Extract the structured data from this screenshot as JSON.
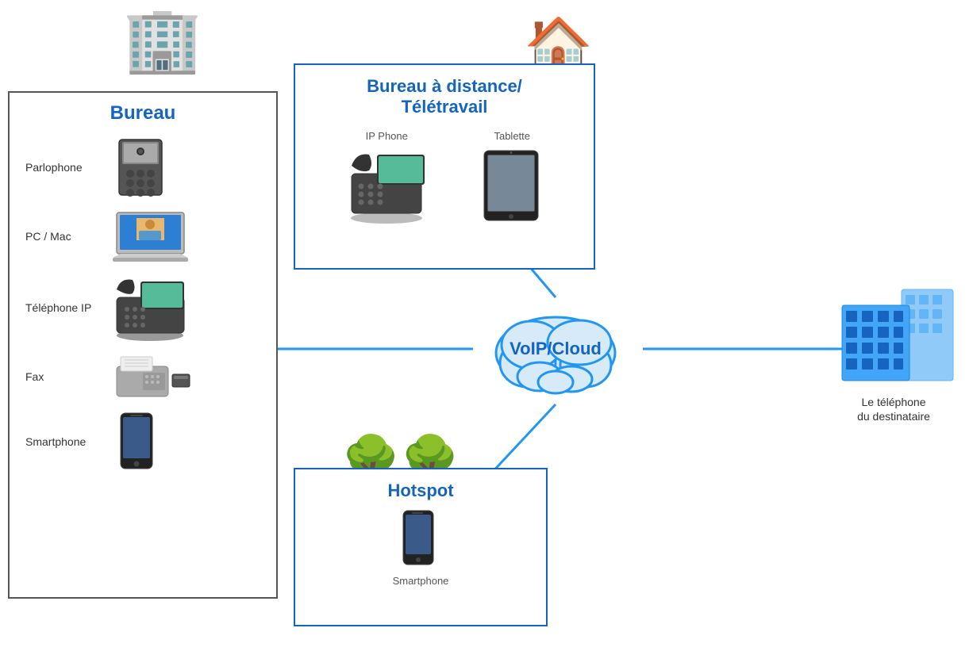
{
  "bureau": {
    "title": "Bureau",
    "items": [
      {
        "label": "Parlophone",
        "icon": "🔲",
        "emoji": "parlophone"
      },
      {
        "label": "PC / Mac",
        "icon": "💻",
        "emoji": "laptop"
      },
      {
        "label": "Téléphone IP",
        "icon": "📞",
        "emoji": "ip-phone"
      },
      {
        "label": "Fax",
        "icon": "🖨️",
        "emoji": "fax"
      },
      {
        "label": "Smartphone",
        "icon": "📱",
        "emoji": "smartphone"
      }
    ]
  },
  "remote": {
    "title_line1": "Bureau à distance/",
    "title_line2": "Télétravail",
    "items": [
      {
        "label": "IP Phone",
        "icon": "📞"
      },
      {
        "label": "Tablette",
        "icon": "📱"
      }
    ]
  },
  "hotspot": {
    "title": "Hotspot",
    "items": [
      {
        "label": "Smartphone",
        "icon": "📱"
      }
    ]
  },
  "voip": {
    "label": "VoIP/Cloud"
  },
  "destination": {
    "label_line1": "Le téléphone",
    "label_line2": "du destinataire"
  },
  "colors": {
    "blue": "#1565c0",
    "line_blue": "#2196F3",
    "border": "#555"
  }
}
